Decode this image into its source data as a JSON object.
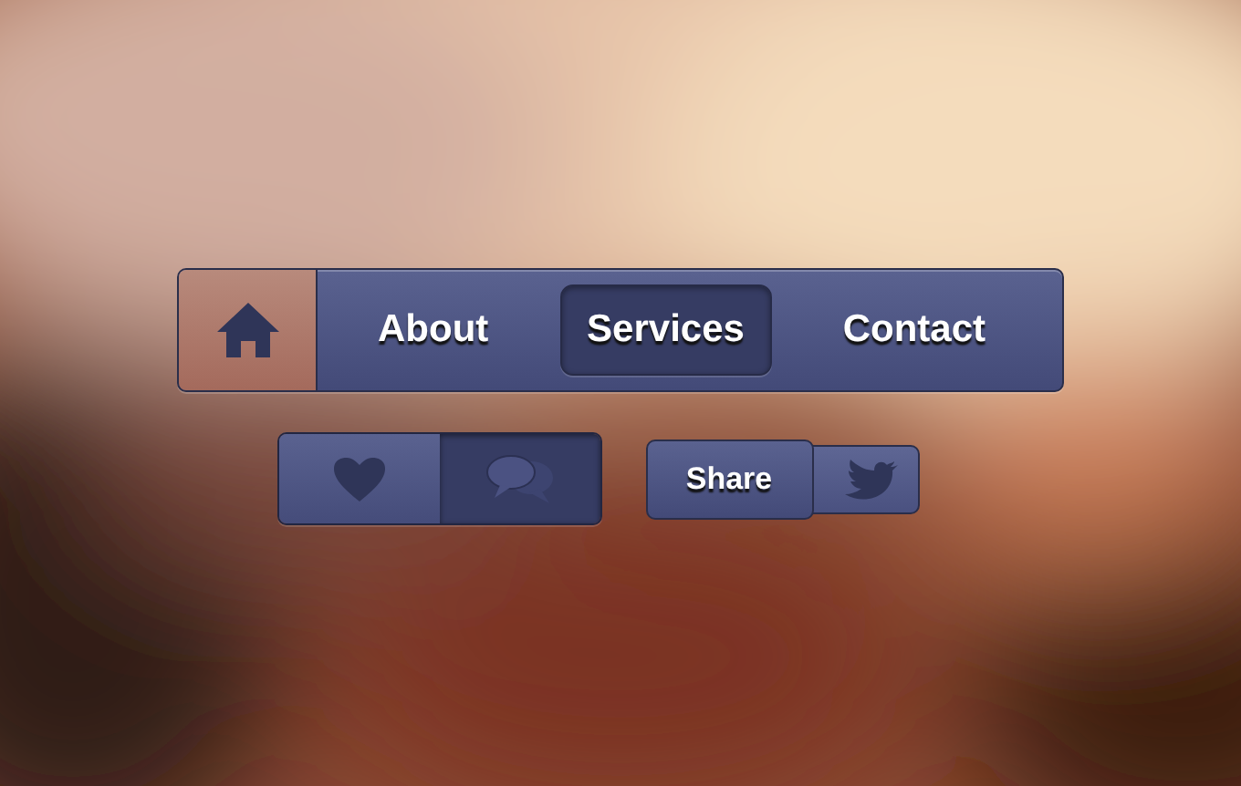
{
  "nav": {
    "home": {
      "active": true
    },
    "items": [
      {
        "label": "About",
        "selected": false
      },
      {
        "label": "Services",
        "selected": true
      },
      {
        "label": "Contact",
        "selected": false
      }
    ]
  },
  "toggles": [
    {
      "kind": "heart",
      "selected": false
    },
    {
      "kind": "chat",
      "selected": true
    }
  ],
  "share": {
    "label": "Share"
  }
}
